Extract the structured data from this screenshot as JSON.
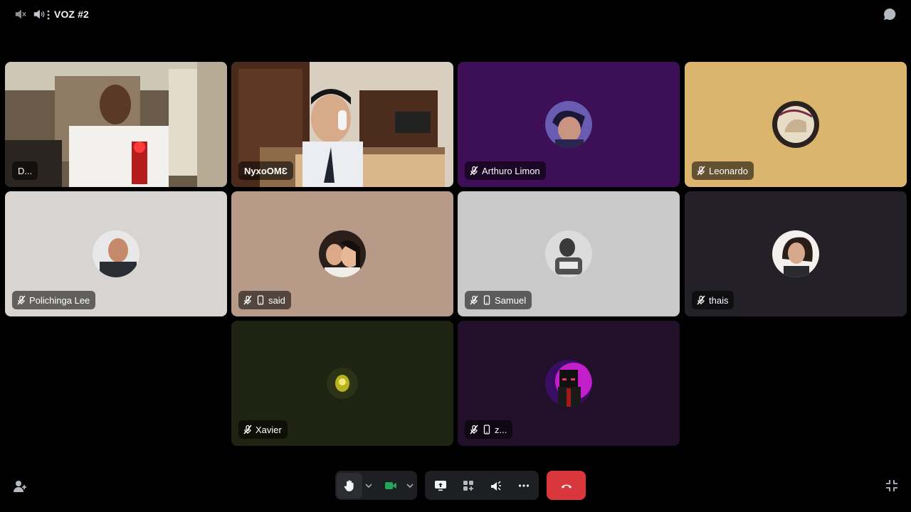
{
  "topbar": {
    "channel_name": "VOZ #2",
    "icons": [
      "speaker-muted-icon",
      "speaker-icon",
      "more-vertical-icon",
      "chat-bubble-icon"
    ]
  },
  "tiles": [
    {
      "name": "D...",
      "type": "video",
      "muted": false,
      "mobile": false,
      "speaking": false,
      "bg": "#3a2f25"
    },
    {
      "name": "NyxoOMƐ",
      "type": "video",
      "muted": false,
      "mobile": false,
      "speaking": true,
      "bg": "#3b2a1c"
    },
    {
      "name": "Arthuro Limon",
      "type": "avatar",
      "muted": true,
      "mobile": false,
      "speaking": false,
      "bg": "#3d0f56"
    },
    {
      "name": "Leonardo",
      "type": "avatar",
      "muted": true,
      "mobile": false,
      "speaking": false,
      "bg": "#dbb56e"
    },
    {
      "name": "Polichinga Lee",
      "type": "avatar",
      "muted": true,
      "mobile": false,
      "speaking": false,
      "bg": "#d7d4d1"
    },
    {
      "name": "said",
      "type": "avatar",
      "muted": true,
      "mobile": true,
      "speaking": false,
      "bg": "#b79a88"
    },
    {
      "name": "Samuel",
      "type": "avatar",
      "muted": true,
      "mobile": true,
      "speaking": false,
      "bg": "#c9c9c9"
    },
    {
      "name": "thais",
      "type": "avatar",
      "muted": true,
      "mobile": false,
      "speaking": false,
      "bg": "#232127"
    },
    {
      "name": "Xavier",
      "type": "avatar",
      "muted": true,
      "mobile": false,
      "speaking": false,
      "bg": "#1f2311"
    },
    {
      "name": "z...",
      "type": "avatar",
      "muted": true,
      "mobile": true,
      "speaking": false,
      "bg": "#22102a"
    }
  ],
  "controls": {
    "buttons": [
      "raise-hand-icon",
      "camera-icon",
      "screen-share-icon",
      "activities-icon",
      "soundboard-icon",
      "more-horizontal-icon",
      "disconnect-icon"
    ],
    "colors": {
      "camera_active": "#23a55a",
      "hangup": "#da373c",
      "speaking_ring": "#2da562"
    }
  },
  "corner": {
    "left_icon": "invite-people-icon",
    "right_icon": "exit-fullscreen-icon"
  }
}
